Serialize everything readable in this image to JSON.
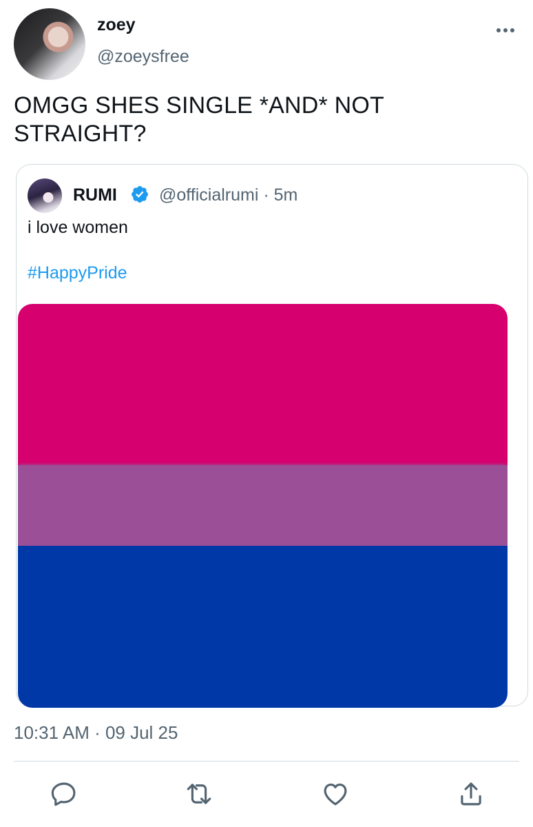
{
  "author": {
    "display_name": "zoey",
    "handle": "@zoeysfree"
  },
  "tweet": {
    "text": "OMGG SHES SINGLE *AND* NOT STRAIGHT?",
    "timestamp": "10:31 AM · 09 Jul 25"
  },
  "quoted_tweet": {
    "display_name": "RUMI",
    "handle_time": "@officialrumi · 5m",
    "text": "i love women",
    "hashtag": "#HappyPride",
    "verified": true,
    "image": {
      "stripe_colors": [
        "#d6006e",
        "#9a4f96",
        "#0038a8"
      ]
    }
  },
  "actions": {
    "icons": [
      "reply-icon",
      "retweet-icon",
      "like-icon",
      "share-icon"
    ]
  },
  "colors": {
    "accent": "#1d9bf0",
    "secondary_text": "#536471",
    "border": "#cfd9de"
  }
}
